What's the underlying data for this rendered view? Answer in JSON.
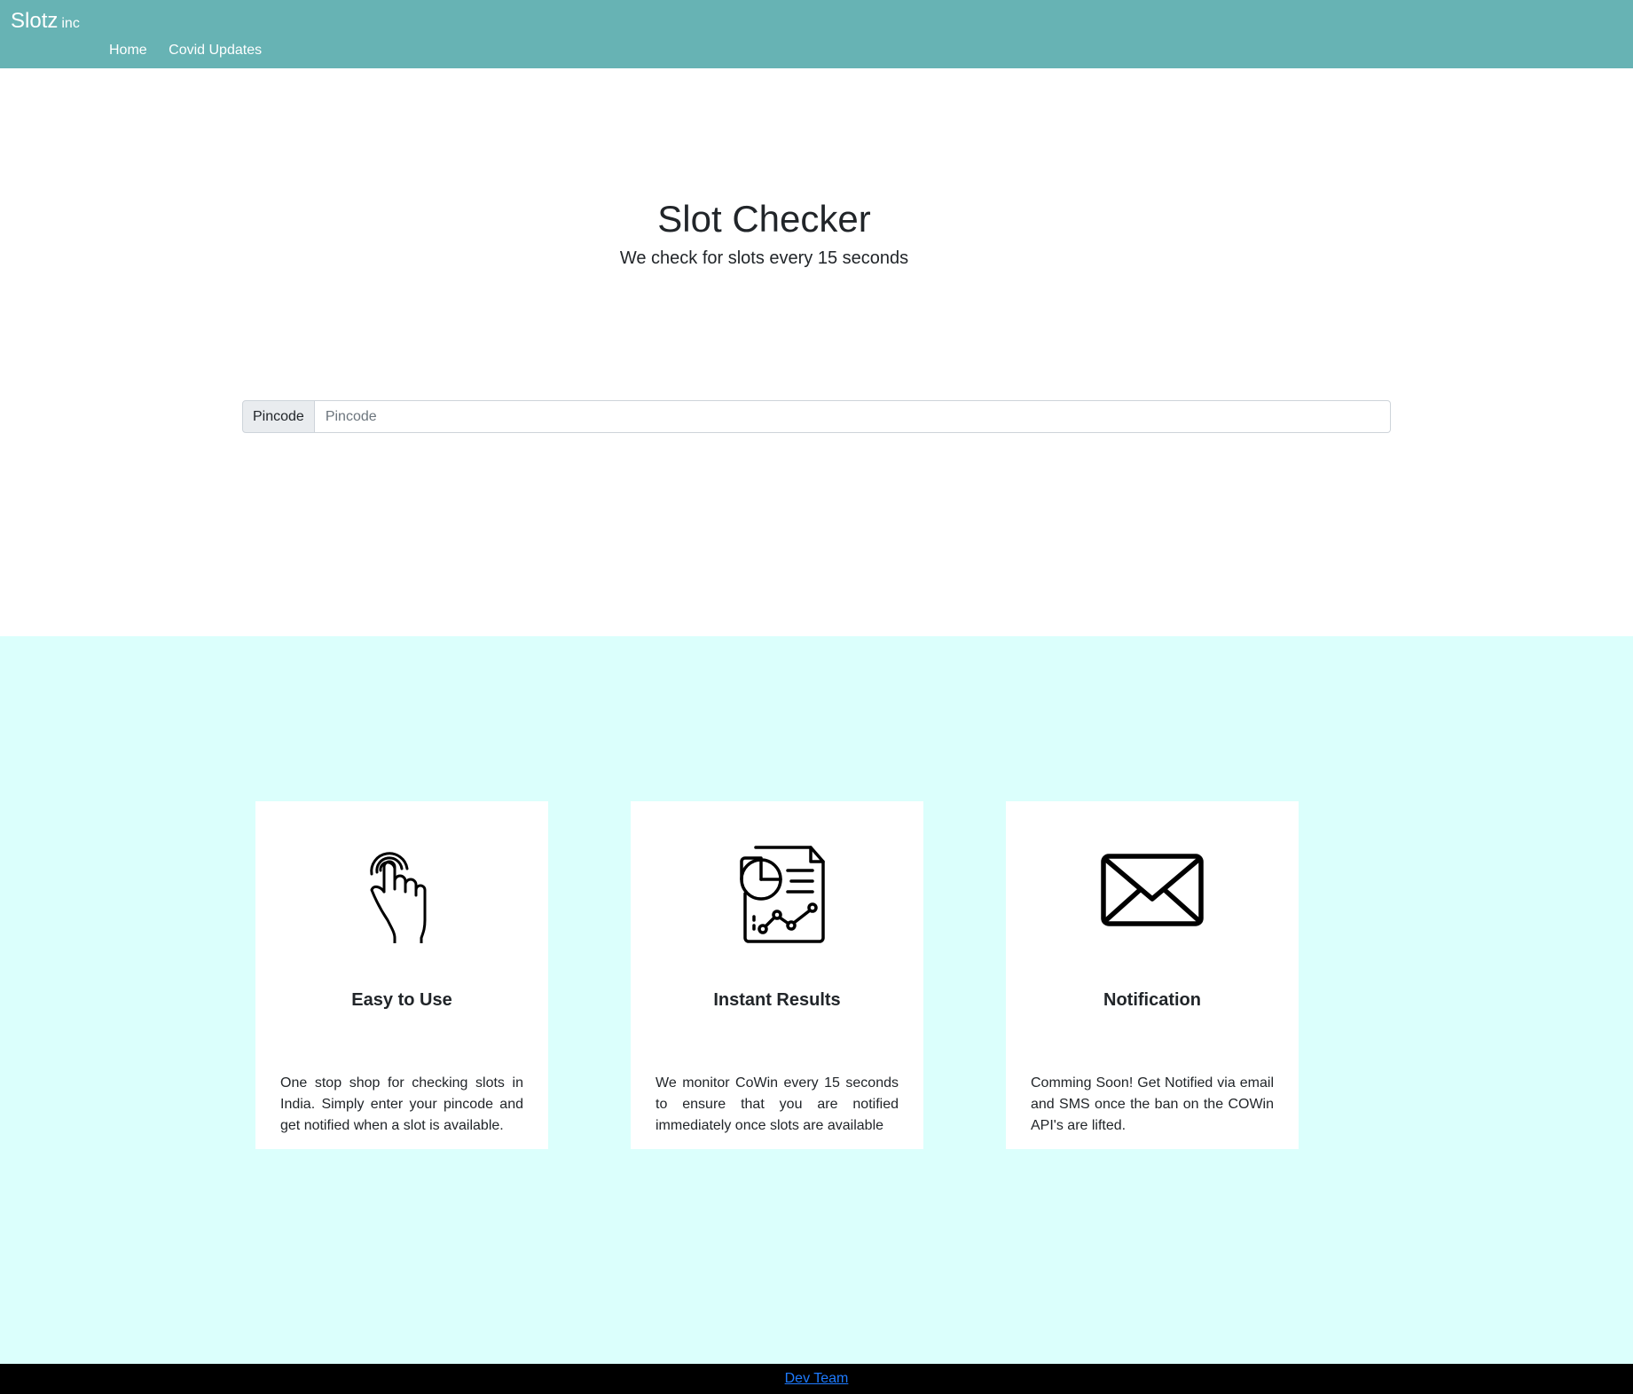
{
  "navbar": {
    "brand": "Slotz",
    "brand_sub": "inc",
    "links": [
      "Home",
      "Covid Updates"
    ],
    "background": "#67b3b4"
  },
  "hero": {
    "title": "Slot Checker",
    "subtitle": "We check for slots every 15 seconds"
  },
  "search": {
    "prefix_label": "Pincode",
    "placeholder": "Pincode",
    "value": ""
  },
  "features": {
    "background": "#dbfffc",
    "cards": [
      {
        "icon": "hand-tap-icon",
        "title": "Easy to Use",
        "description": "One stop shop for checking slots in India. Simply enter your pincode and get notified when a slot is available."
      },
      {
        "icon": "report-chart-icon",
        "title": "Instant Results",
        "description": "We monitor CoWin every 15 seconds to ensure that you are notified immediately once slots are available"
      },
      {
        "icon": "envelope-icon",
        "title": "Notification",
        "description": "Comming Soon! Get Notified via email and SMS once the ban on the COWin API's are lifted."
      }
    ]
  },
  "footer": {
    "link_text": "Dev Team"
  }
}
